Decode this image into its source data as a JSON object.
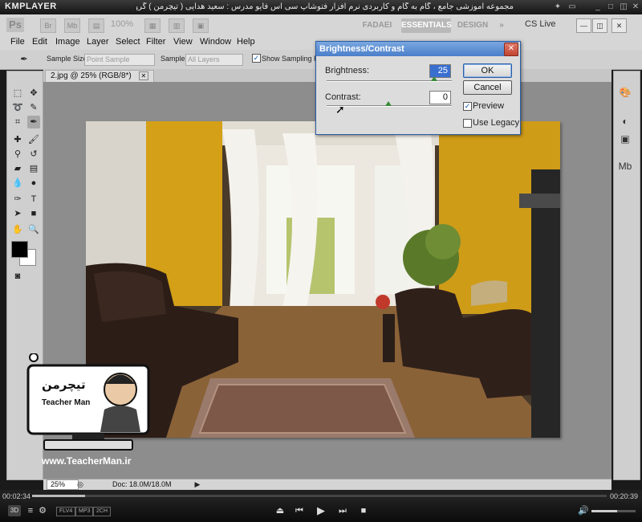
{
  "player": {
    "logo": "KMPLAYER",
    "title": "مجموعه آموزشی جامع ، گام به گام و کاربردی نرم افزار فتوشاپ سی اس فایو   مدرس : سعید هدایی ( تیچرمن ) گروه آموزشی پادشاه گرافیست ها",
    "elapsed": "00:02:34",
    "total": "00:20:39",
    "progress_fraction": 0.092,
    "volume_fraction": 0.58,
    "badges": [
      "FLV4",
      "MP3",
      "2CH"
    ],
    "mode_label": "3D"
  },
  "appbar": {
    "logo": "Ps",
    "zoom": "100%",
    "workspaces": [
      "FADAEI",
      "ESSENTIALS",
      "DESIGN"
    ],
    "active_workspace": "ESSENTIALS",
    "cs_live": "CS Live"
  },
  "menu": [
    "File",
    "Edit",
    "Image",
    "Layer",
    "Select",
    "Filter",
    "View",
    "Window",
    "Help"
  ],
  "options": {
    "sample_size_label": "Sample Size:",
    "sample_size_value": "Point Sample",
    "sample_label": "Sample:",
    "sample_value": "All Layers",
    "show_ring_label": "Show Sampling Rin"
  },
  "document": {
    "tab_title": "2.jpg @ 25% (RGB/8*)",
    "status_zoom": "25%",
    "status_doc": "Doc: 18.0M/18.0M"
  },
  "dialog": {
    "title": "Brightness/Contrast",
    "brightness_label": "Brightness:",
    "brightness_value": "25",
    "contrast_label": "Contrast:",
    "contrast_value": "0",
    "ok_label": "OK",
    "cancel_label": "Cancel",
    "preview_label": "Preview",
    "preview_checked": true,
    "legacy_label": "Use Legacy",
    "legacy_checked": false
  },
  "watermark": {
    "brand_fa": "تیچرمن",
    "brand_en": "Teacher Man",
    "url": "www.TeacherMan.ir"
  }
}
